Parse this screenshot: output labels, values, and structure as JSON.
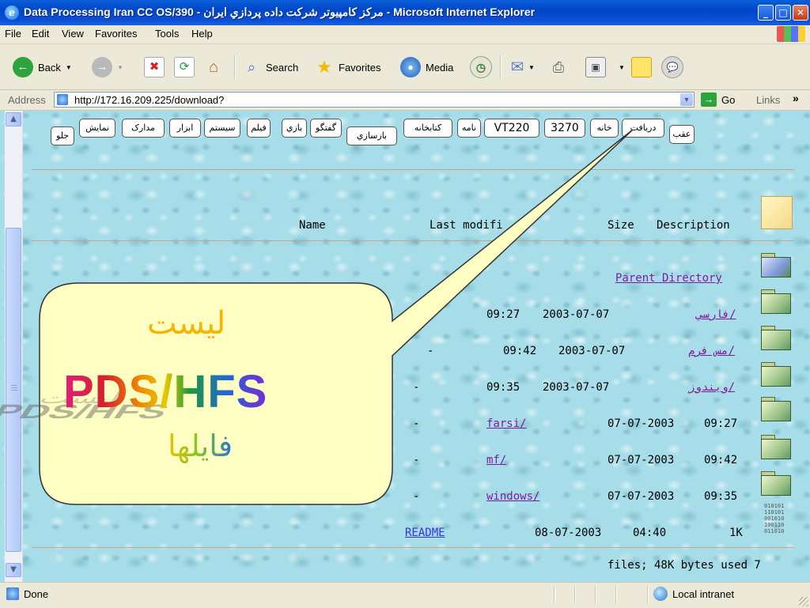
{
  "window": {
    "title": "Data Processing Iran CC OS/390 - مرکز کامپیوتر شرکت داده پردازي ايران - Microsoft Internet Explorer",
    "minimize_glyph": "_",
    "maximize_glyph": "□",
    "close_glyph": "✕"
  },
  "menu": [
    "File",
    "Edit",
    "View",
    "Favorites",
    "Tools",
    "Help"
  ],
  "toolbar": {
    "back": "Back",
    "search": "Search",
    "favorites": "Favorites",
    "media": "Media"
  },
  "address": {
    "label": "Address",
    "url": "http://172.16.209.225/download?",
    "go": "Go",
    "links": "Links",
    "chevron": "»"
  },
  "nav_buttons": {
    "back_fa": "عقب",
    "download": "دريافت",
    "home": "خانه",
    "b3270": "3270",
    "vt220": "VT220",
    "mail": "نامه",
    "library": "کتابخانه",
    "build": "بازسازي",
    "chat": "گفتگو",
    "game": "بازي",
    "film": "فيلم",
    "system": "سيستم",
    "tools": "ابزار",
    "docs": "مدارک",
    "show": "نمايش",
    "forward": "جلو"
  },
  "listing": {
    "headers": {
      "name": "Name",
      "last_modified": "Last modifi",
      "size": "Size",
      "description": "Description"
    },
    "parent": "Parent Directory",
    "rows": [
      {
        "time": "09:27",
        "date": "2003-07-07",
        "name": "فارسي/"
      },
      {
        "dash": "-",
        "time": "09:42",
        "date": "2003-07-07",
        "name": "مس فرم/"
      },
      {
        "dash": "-",
        "time": "09:35",
        "date": "2003-07-07",
        "name": "ويندوز/"
      },
      {
        "dash": "-",
        "name": "farsi/",
        "date": "07-07-2003",
        "time": "09:27"
      },
      {
        "dash": "-",
        "name": "mf/",
        "date": "07-07-2003",
        "time": "09:42"
      },
      {
        "dash": "-",
        "name": "windows/",
        "date": "07-07-2003",
        "time": "09:35"
      }
    ],
    "readme": {
      "name": "README",
      "date": "08-07-2003",
      "time": "04:40",
      "size": "1K"
    },
    "footer": "files; 48K bytes used 7"
  },
  "callout": {
    "list_word": "ليست",
    "system": "PDS/HFS",
    "files_word": "فايلها"
  },
  "status": {
    "text": "Done",
    "zone": "Local intranet"
  },
  "colors": {
    "titlebar": "#0046c8",
    "chrome": "#ece9d8",
    "content_bg": "#a6dde8",
    "link": "#3333ee",
    "visited_link": "#801a9c",
    "callout_fill": "#ffffc4"
  },
  "icons": [
    "ie-icon",
    "back-arrow-icon",
    "forward-arrow-icon",
    "stop-icon",
    "refresh-icon",
    "home-icon",
    "search-icon",
    "favorites-star-icon",
    "media-icon",
    "history-icon",
    "mail-icon",
    "print-icon",
    "edit-icon",
    "notes-icon",
    "messenger-icon",
    "folder-icon",
    "binary-file-icon"
  ]
}
